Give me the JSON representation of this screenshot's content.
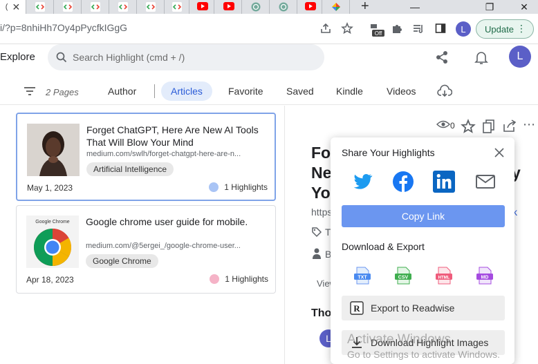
{
  "browser": {
    "url": "i/?p=8nhiHh7Oy4pPycfkIGgG",
    "profile_initial": "L",
    "update_label": "Update",
    "extension_badge": "Off"
  },
  "header": {
    "explore_label": "Explore",
    "search_placeholder": "Search Highlight (cmd + /)",
    "avatar_initial": "L"
  },
  "tabs": {
    "pages_count": "2 Pages",
    "items": [
      "Author",
      "Articles",
      "Favorite",
      "Saved",
      "Kindle",
      "Videos"
    ],
    "active": "Articles"
  },
  "articles": [
    {
      "title": "Forget ChatGPT, Here Are New AI Tools That Will Blow Your Mind",
      "url": "medium.com/swlh/forget-chatgpt-here-are-n...",
      "tag": "Artificial Intelligence",
      "date": "May 1, 2023",
      "highlights": "1 Highlights",
      "dot_color": "#a9c4f5"
    },
    {
      "title": "Google chrome user guide for mobile.",
      "url": "medium.com/@5ergei_/google-chrome-user...",
      "tag": "Google Chrome",
      "date": "Apr 18, 2023",
      "highlights": "1 Highlights",
      "dot_color": "#f5b3c7",
      "thumb_label": "Google Chrome"
    }
  ],
  "detail": {
    "views": "0",
    "title_lines": [
      "Fo",
      "Ne",
      "Yo"
    ],
    "frag_url": "https",
    "frag_tag": "T",
    "frag_author": "B",
    "frag_view": "View",
    "frag_tho": "Tho",
    "frag_link": "k",
    "frag_y": "y"
  },
  "share_popup": {
    "title": "Share Your Highlights",
    "copy_link": "Copy Link",
    "download_title": "Download & Export",
    "formats": [
      "TXT",
      "CSV",
      "HTML",
      "MD"
    ],
    "export_readwise": "Export to Readwise",
    "download_images": "Download Highlight Images"
  },
  "os_watermark": {
    "line1": "Activate Windows",
    "line2": "Go to Settings to activate Windows."
  },
  "colors": {
    "accent": "#6b96f0",
    "active_tab_bg": "#e3ecfb",
    "avatar": "#5b5fc7",
    "twitter": "#1d9bf0",
    "facebook": "#1877f2",
    "linkedin": "#0a66c2"
  }
}
